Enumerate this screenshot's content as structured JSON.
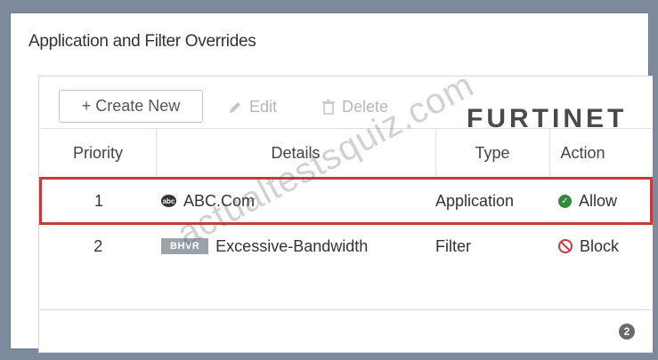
{
  "window": {
    "title": "Application and Filter Overrides"
  },
  "toolbar": {
    "create_label": "+ Create New",
    "edit_label": "Edit",
    "delete_label": "Delete"
  },
  "branding": {
    "logo_text": "FURTINET"
  },
  "table": {
    "headers": [
      "Priority",
      "Details",
      "Type",
      "Action"
    ],
    "rows": [
      {
        "priority": "1",
        "details": "ABC.Com",
        "icon": "abc-logo-icon",
        "type": "Application",
        "action": "Allow",
        "selected": true
      },
      {
        "priority": "2",
        "details": "Excessive-Bandwidth",
        "badge": "BHVR",
        "type": "Filter",
        "action": "Block",
        "selected": false
      }
    ]
  },
  "footer": {
    "help_count": "2"
  },
  "watermark": "actualtestsquiz.com",
  "colors": {
    "selection": "#c8383f",
    "allow": "#2e8b3a",
    "block": "#c83a3a"
  }
}
